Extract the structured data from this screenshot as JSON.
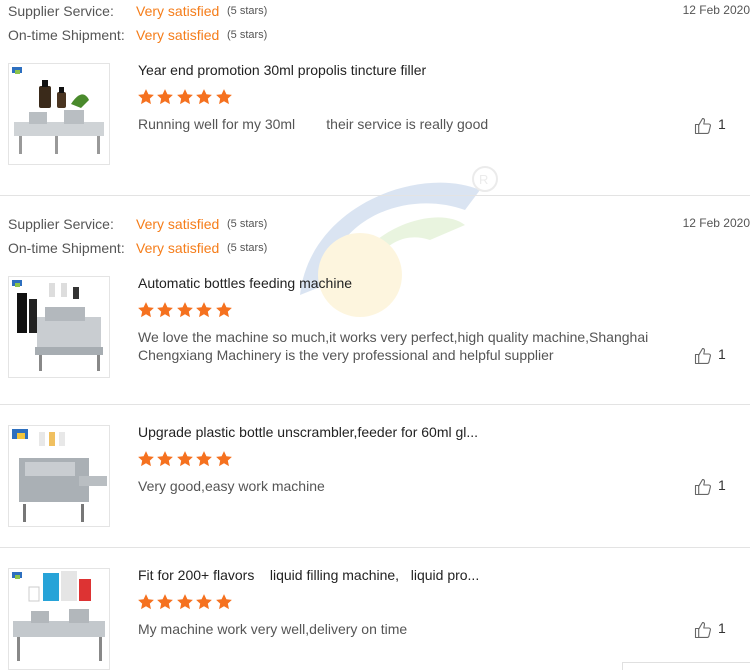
{
  "labels": {
    "supplier_service": "Supplier Service:",
    "ontime_shipment": "On-time Shipment:"
  },
  "colors": {
    "accent": "#f57d1a",
    "star": "#f5711f",
    "separator": "#e3e3e3"
  },
  "icons": {
    "rating": "star-icon",
    "like": "thumbs-up-icon",
    "watermark": "brand-logo-watermark"
  },
  "reviews": [
    {
      "supplier_service": "Very satisfied",
      "supplier_service_note": "(5 stars)",
      "ontime_shipment": "Very satisfied",
      "ontime_shipment_note": "(5 stars)",
      "date": "12 Feb 2020",
      "title": "Year end promotion 30ml propolis tincture filler",
      "rating": 5,
      "comment": "Running well for my 30ml        their service is really good",
      "likes": "1"
    },
    {
      "supplier_service": "Very satisfied",
      "supplier_service_note": "(5 stars)",
      "ontime_shipment": "Very satisfied",
      "ontime_shipment_note": "(5 stars)",
      "date": "12 Feb 2020",
      "title": "Automatic bottles feeding machine",
      "rating": 5,
      "comment": "We love the machine so much,it works very perfect,high quality machine,Shanghai Chengxiang Machinery is the very professional and helpful supplier",
      "likes": "1"
    },
    {
      "title": "Upgrade plastic bottle unscrambler,feeder for 60ml gl...",
      "rating": 5,
      "comment": "Very good,easy work machine",
      "likes": "1"
    },
    {
      "title": "Fit for 200+ flavors    liquid filling machine,   liquid pro...",
      "rating": 5,
      "comment": "My machine work very well,delivery on time",
      "likes": "1"
    }
  ]
}
